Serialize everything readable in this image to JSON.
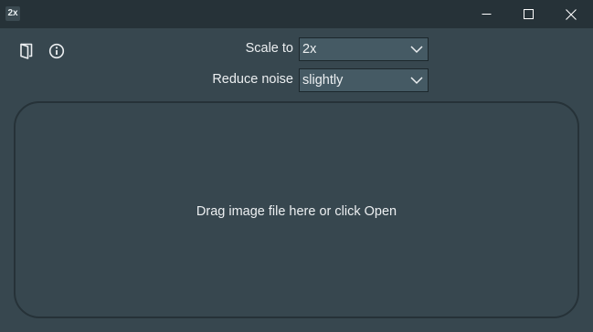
{
  "window": {
    "title": "2x",
    "controls": {
      "minimize": "minimize-icon",
      "maximize": "maximize-icon",
      "close": "close-icon"
    }
  },
  "toolbar": {
    "open_icon": "open-door-icon",
    "info_icon": "info-icon"
  },
  "settings": {
    "scale_label": "Scale to",
    "scale_value": "2x",
    "noise_label": "Reduce noise",
    "noise_value": "slightly"
  },
  "dropzone": {
    "text": "Drag image file here or click Open"
  },
  "colors": {
    "background": "#37474f",
    "titlebar": "#263238",
    "select_bg": "#455a64",
    "text": "#eceff1"
  }
}
